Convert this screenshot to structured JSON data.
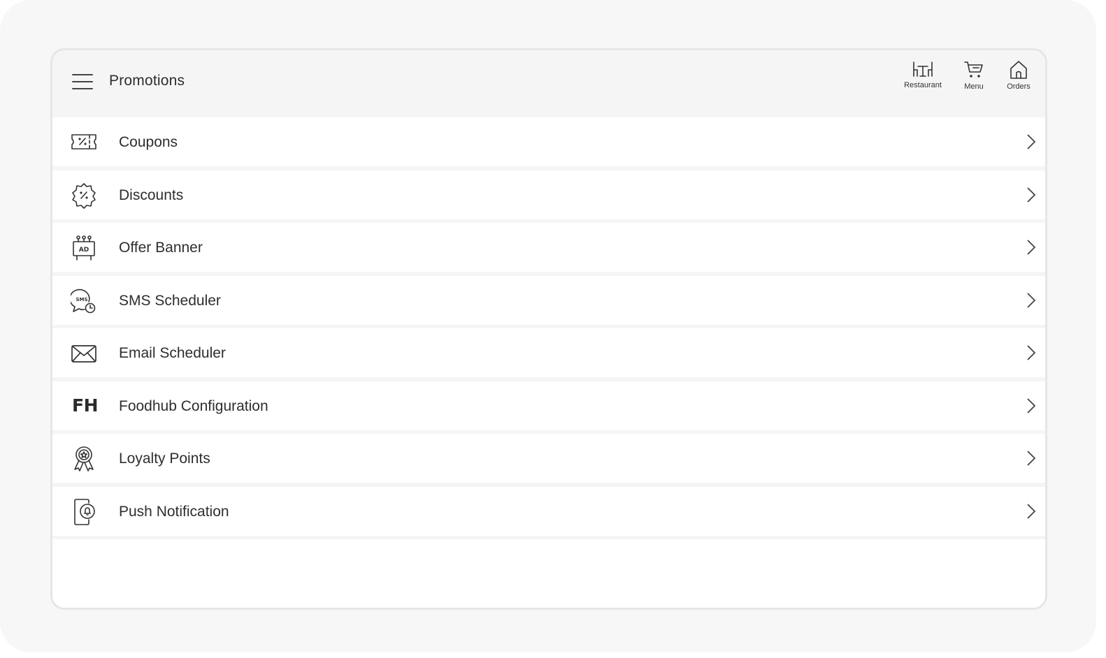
{
  "header": {
    "title": "Promotions",
    "nav": [
      {
        "label": "Restaurant",
        "icon": "restaurant-icon"
      },
      {
        "label": "Menu",
        "icon": "cart-icon"
      },
      {
        "label": "Orders",
        "icon": "home-icon"
      }
    ]
  },
  "items": [
    {
      "label": "Coupons",
      "icon": "coupon-icon"
    },
    {
      "label": "Discounts",
      "icon": "discount-badge-icon"
    },
    {
      "label": "Offer Banner",
      "icon": "ad-banner-icon",
      "icon_text": "AD"
    },
    {
      "label": "SMS Scheduler",
      "icon": "sms-clock-icon",
      "icon_text": "SMS"
    },
    {
      "label": "Email Scheduler",
      "icon": "envelope-icon"
    },
    {
      "label": "Foodhub Configuration",
      "icon": "foodhub-logo-icon",
      "icon_text": "FH"
    },
    {
      "label": "Loyalty Points",
      "icon": "award-ribbon-icon"
    },
    {
      "label": "Push Notification",
      "icon": "phone-notification-icon"
    }
  ]
}
